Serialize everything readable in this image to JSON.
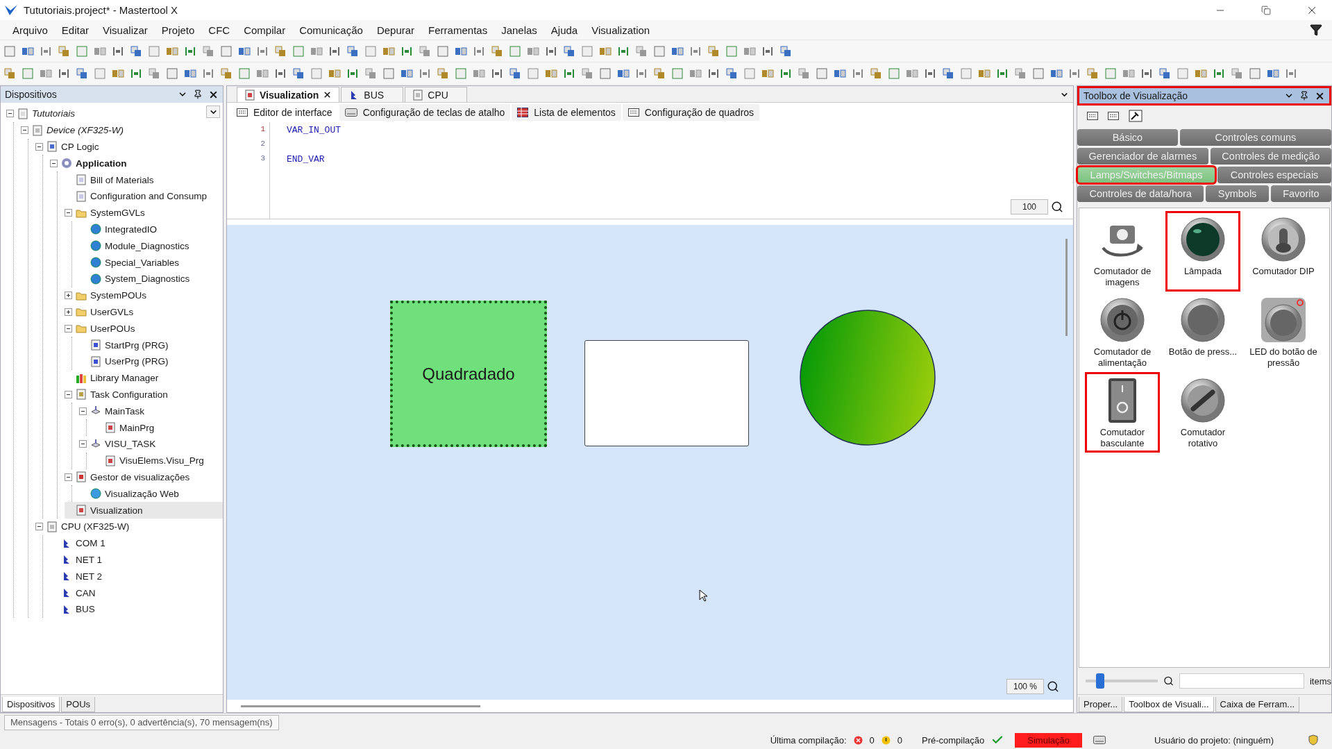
{
  "window": {
    "title": "Tututoriais.project* - Mastertool X"
  },
  "menu": [
    {
      "label": "Arquivo"
    },
    {
      "label": "Editar"
    },
    {
      "label": "Visualizar"
    },
    {
      "label": "Projeto"
    },
    {
      "label": "CFC"
    },
    {
      "label": "Compilar"
    },
    {
      "label": "Comunicação"
    },
    {
      "label": "Depurar"
    },
    {
      "label": "Ferramentas"
    },
    {
      "label": "Janelas"
    },
    {
      "label": "Ajuda"
    },
    {
      "label": "Visualization"
    }
  ],
  "devices": {
    "title": "Dispositivos",
    "tree": [
      {
        "label": "Tututoriais",
        "kind": "project",
        "expanded": true,
        "children": [
          {
            "label": "Device (XF325-W)",
            "kind": "offline_device",
            "expanded": true,
            "children": [
              {
                "label": "CP Logic",
                "kind": "logic",
                "expanded": true,
                "children": [
                  {
                    "label": "Application",
                    "kind": "application",
                    "expanded": true,
                    "children": [
                      {
                        "label": "Bill of Materials",
                        "kind": "doc"
                      },
                      {
                        "label": "Configuration and Consump",
                        "kind": "doc"
                      },
                      {
                        "label": "SystemGVLs",
                        "kind": "folder",
                        "expanded": true,
                        "children": [
                          {
                            "label": "IntegratedIO",
                            "kind": "globe"
                          },
                          {
                            "label": "Module_Diagnostics",
                            "kind": "globe"
                          },
                          {
                            "label": "Special_Variables",
                            "kind": "globe"
                          },
                          {
                            "label": "System_Diagnostics",
                            "kind": "globe"
                          }
                        ]
                      },
                      {
                        "label": "SystemPOUs",
                        "kind": "folder",
                        "expanded": false
                      },
                      {
                        "label": "UserGVLs",
                        "kind": "folder",
                        "expanded": false
                      },
                      {
                        "label": "UserPOUs",
                        "kind": "folder",
                        "expanded": true,
                        "children": [
                          {
                            "label": "StartPrg (PRG)",
                            "kind": "prg"
                          },
                          {
                            "label": "UserPrg (PRG)",
                            "kind": "prg"
                          }
                        ]
                      },
                      {
                        "label": "Library Manager",
                        "kind": "library"
                      },
                      {
                        "label": "Task Configuration",
                        "kind": "taskconfig",
                        "expanded": true,
                        "children": [
                          {
                            "label": "MainTask",
                            "kind": "task",
                            "expanded": true,
                            "children": [
                              {
                                "label": "MainPrg",
                                "kind": "visu"
                              }
                            ]
                          },
                          {
                            "label": "VISU_TASK",
                            "kind": "task",
                            "expanded": true,
                            "children": [
                              {
                                "label": "VisuElems.Visu_Prg",
                                "kind": "visu"
                              }
                            ]
                          }
                        ]
                      },
                      {
                        "label": "Gestor de visualizações",
                        "kind": "manager",
                        "expanded": true,
                        "children": [
                          {
                            "label": "Visualização Web",
                            "kind": "web"
                          }
                        ]
                      },
                      {
                        "label": "Visualization",
                        "kind": "visu",
                        "selected": true
                      }
                    ]
                  }
                ]
              },
              {
                "label": "CPU (XF325-W)",
                "kind": "device",
                "expanded": true,
                "children": [
                  {
                    "label": "COM 1",
                    "kind": "port"
                  },
                  {
                    "label": "NET 1",
                    "kind": "port"
                  },
                  {
                    "label": "NET 2",
                    "kind": "port"
                  },
                  {
                    "label": "CAN",
                    "kind": "port"
                  },
                  {
                    "label": "BUS",
                    "kind": "port"
                  }
                ]
              }
            ]
          }
        ]
      }
    ]
  },
  "left_tabs": [
    {
      "label": "Dispositivos",
      "selected": true
    },
    {
      "label": "POUs",
      "selected": false
    }
  ],
  "editor": {
    "tabs": [
      {
        "label": "Visualization",
        "kind": "visu",
        "selected": true
      },
      {
        "label": "BUS",
        "kind": "port",
        "selected": false
      },
      {
        "label": "CPU",
        "kind": "device",
        "selected": false
      }
    ],
    "subtabs": [
      {
        "label": "Editor de interface",
        "kind": "keys",
        "selected": true
      },
      {
        "label": "Configuração de teclas de atalho",
        "kind": "keyboard",
        "selected": false
      },
      {
        "label": "Lista de elementos",
        "kind": "table",
        "selected": false
      },
      {
        "label": "Configuração de quadros",
        "kind": "keys",
        "selected": false
      }
    ],
    "code": [
      {
        "number": "1",
        "text": "VAR_IN_OUT"
      },
      {
        "number": "2"
      },
      {
        "number": "3",
        "text": "END_VAR"
      }
    ],
    "code_zoom": "100",
    "canvas": {
      "elements": [
        {
          "kind": "rectangle",
          "label": "Quadradado",
          "selected": true
        },
        {
          "kind": "rectangle",
          "selected": false
        },
        {
          "kind": "lamp"
        }
      ],
      "zoom": "100 %"
    }
  },
  "toolbox": {
    "title": "Toolbox de Visualização",
    "highlighted": true,
    "category_rows": [
      [
        {
          "label": "Básico",
          "selected": false,
          "highlighted": false
        },
        {
          "label": "Controles comuns",
          "selected": false,
          "highlighted": false
        }
      ],
      [
        {
          "label": "Gerenciador de alarmes",
          "selected": false,
          "highlighted": false
        },
        {
          "label": "Controles de medição",
          "selected": false,
          "highlighted": false
        }
      ],
      [
        {
          "label": "Lamps/Switches/Bitmaps",
          "selected": true,
          "highlighted": true
        },
        {
          "label": "Controles especiais",
          "selected": false,
          "highlighted": false
        }
      ],
      [
        {
          "label": "Controles de data/hora",
          "selected": false,
          "highlighted": false
        },
        {
          "label": "Symbols",
          "selected": false,
          "highlighted": false
        },
        {
          "label": "Favorito",
          "selected": false,
          "highlighted": false
        }
      ]
    ],
    "items": [
      {
        "label": "Comutador de imagens",
        "kind": "camera",
        "highlighted": false
      },
      {
        "label": "Lâmpada",
        "kind": "lamp",
        "highlighted": true
      },
      {
        "label": "Comutador DIP",
        "kind": "dip",
        "highlighted": false
      },
      {
        "label": "Comutador de alimentação",
        "kind": "power",
        "highlighted": false
      },
      {
        "label": "Botão de press...",
        "kind": "push",
        "highlighted": false
      },
      {
        "label": "LED do botão de pressão",
        "kind": "ledpush",
        "highlighted": false
      },
      {
        "label": "Comutador basculante",
        "kind": "rocker",
        "highlighted": true
      },
      {
        "label": "Comutador rotativo",
        "kind": "rotary",
        "highlighted": false
      }
    ],
    "slider": {
      "level": 0.2
    },
    "search_suffix": "items"
  },
  "right_tabs": [
    {
      "label": "Proper...",
      "selected": false
    },
    {
      "label": "Toolbox de Visuali...",
      "selected": true
    },
    {
      "label": "Caixa de Ferram...",
      "selected": false
    }
  ],
  "messages": "Mensagens - Totais 0 erro(s), 0 advertência(s), 70 mensagem(ns)",
  "status": {
    "last_compile": "Última compilação:",
    "errors": "0",
    "warnings": "0",
    "precompile": "Pré-compilação",
    "mode": "Simulação",
    "user": "Usuário do projeto: (ninguém)"
  }
}
